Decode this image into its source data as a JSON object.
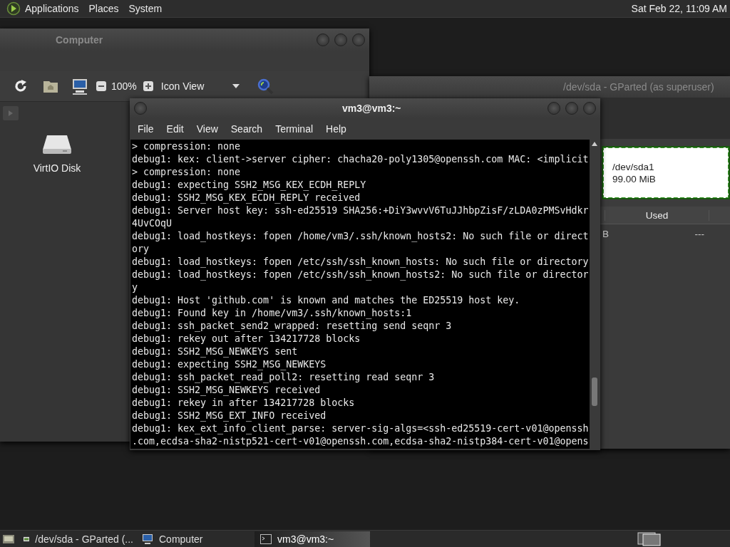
{
  "top_panel": {
    "menus": [
      "Applications",
      "Places",
      "System"
    ],
    "clock": "Sat Feb 22, 11:09 AM"
  },
  "file_manager": {
    "title": "Computer",
    "zoom": "100%",
    "view": "Icon View",
    "items": [
      {
        "label": "VirtIO Disk"
      }
    ]
  },
  "gparted": {
    "title": "/dev/sda - GParted (as superuser)",
    "partition": {
      "name": "/dev/sda1",
      "size": "99.00 MiB"
    },
    "columns": [
      "Used"
    ],
    "rows": [
      [
        "B",
        "---"
      ]
    ]
  },
  "terminal": {
    "title": "vm3@vm3:~",
    "menu": [
      "File",
      "Edit",
      "View",
      "Search",
      "Terminal",
      "Help"
    ],
    "lines": [
      "> compression: none",
      "debug1: kex: client->server cipher: chacha20-poly1305@openssh.com MAC: <implicit",
      "> compression: none",
      "debug1: expecting SSH2_MSG_KEX_ECDH_REPLY",
      "debug1: SSH2_MSG_KEX_ECDH_REPLY received",
      "debug1: Server host key: ssh-ed25519 SHA256:+DiY3wvvV6TuJJhbpZisF/zLDA0zPMSvHdkr",
      "4UvCOqU",
      "debug1: load_hostkeys: fopen /home/vm3/.ssh/known_hosts2: No such file or direct",
      "ory",
      "debug1: load_hostkeys: fopen /etc/ssh/ssh_known_hosts: No such file or directory",
      "debug1: load_hostkeys: fopen /etc/ssh/ssh_known_hosts2: No such file or director",
      "y",
      "debug1: Host 'github.com' is known and matches the ED25519 host key.",
      "debug1: Found key in /home/vm3/.ssh/known_hosts:1",
      "debug1: ssh_packet_send2_wrapped: resetting send seqnr 3",
      "debug1: rekey out after 134217728 blocks",
      "debug1: SSH2_MSG_NEWKEYS sent",
      "debug1: expecting SSH2_MSG_NEWKEYS",
      "debug1: ssh_packet_read_poll2: resetting read seqnr 3",
      "debug1: SSH2_MSG_NEWKEYS received",
      "debug1: rekey in after 134217728 blocks",
      "debug1: SSH2_MSG_EXT_INFO received",
      "debug1: kex_ext_info_client_parse: server-sig-algs=<ssh-ed25519-cert-v01@openssh",
      ".com,ecdsa-sha2-nistp521-cert-v01@openssh.com,ecdsa-sha2-nistp384-cert-v01@opens"
    ]
  },
  "taskbar": {
    "tasks": [
      {
        "label": "/dev/sda - GParted (...",
        "kind": "gparted",
        "selected": false
      },
      {
        "label": "Computer",
        "kind": "computer",
        "selected": false
      },
      {
        "label": "vm3@vm3:~",
        "kind": "terminal",
        "selected": true
      }
    ]
  }
}
